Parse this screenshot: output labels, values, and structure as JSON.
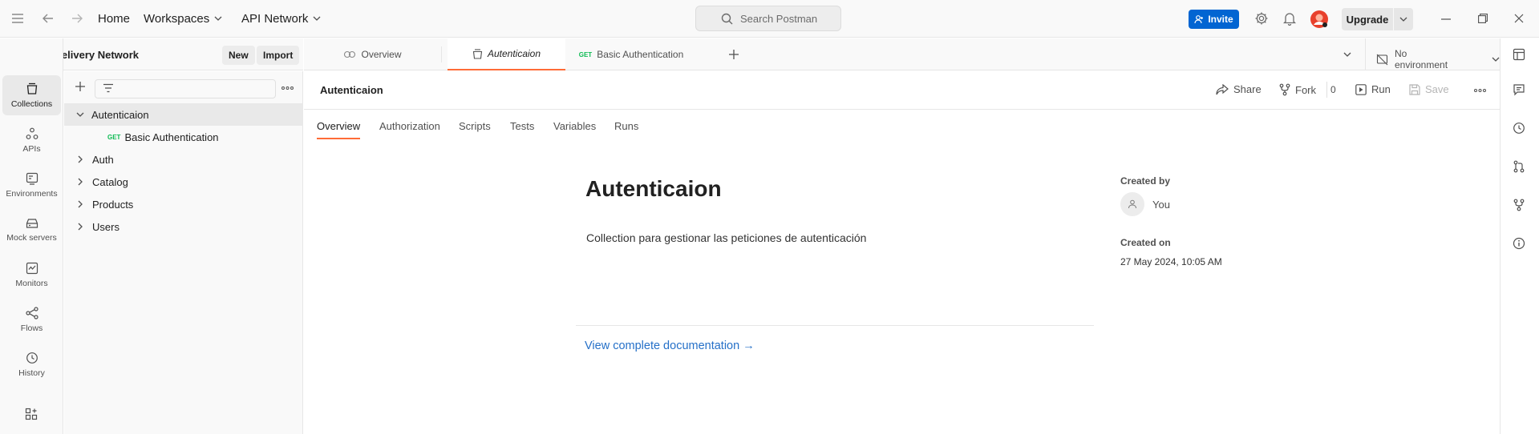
{
  "titlebar": {
    "home": "Home",
    "workspaces": "Workspaces",
    "workspace_name": "API Network",
    "search_placeholder": "Search Postman",
    "invite": "Invite",
    "upgrade": "Upgrade"
  },
  "sidebar": {
    "workspace_title": "Java Delivery Network",
    "new_label": "New",
    "import_label": "Import",
    "tree": [
      {
        "label": "Autenticaion",
        "expanded": true,
        "selected": true
      },
      {
        "label": "Basic Authentication",
        "method": "GET"
      },
      {
        "label": "Auth"
      },
      {
        "label": "Catalog"
      },
      {
        "label": "Products"
      },
      {
        "label": "Users"
      }
    ]
  },
  "rail": {
    "items": [
      {
        "label": "Collections",
        "icon": "collections-icon",
        "active": true
      },
      {
        "label": "APIs",
        "icon": "apis-icon"
      },
      {
        "label": "Environments",
        "icon": "environments-icon"
      },
      {
        "label": "Mock servers",
        "icon": "mock-servers-icon"
      },
      {
        "label": "Monitors",
        "icon": "monitors-icon"
      },
      {
        "label": "Flows",
        "icon": "flows-icon"
      },
      {
        "label": "History",
        "icon": "history-icon"
      }
    ]
  },
  "tabs": {
    "items": [
      {
        "label": "Overview",
        "icon": "overview-icon"
      },
      {
        "label": "Autenticaion",
        "icon": "collection-icon",
        "active": true
      },
      {
        "label": "Basic Authentication",
        "method": "GET"
      }
    ],
    "environment": "No environment"
  },
  "content": {
    "header_title": "Autenticaion",
    "share": "Share",
    "fork": "Fork",
    "fork_count": "0",
    "run": "Run",
    "save": "Save",
    "subtabs": [
      "Overview",
      "Authorization",
      "Scripts",
      "Tests",
      "Variables",
      "Runs"
    ],
    "doc_title": "Autenticaion",
    "doc_description": "Collection para gestionar las peticiones de autenticación",
    "view_docs": "View complete documentation →",
    "created_by_label": "Created by",
    "created_by": "You",
    "created_on_label": "Created on",
    "created_on": "27 May 2024, 10:05 AM"
  },
  "colors": {
    "accent": "#ff6c37",
    "invite": "#0265d2",
    "link": "#2570c8",
    "get_method": "#0cbb52"
  }
}
